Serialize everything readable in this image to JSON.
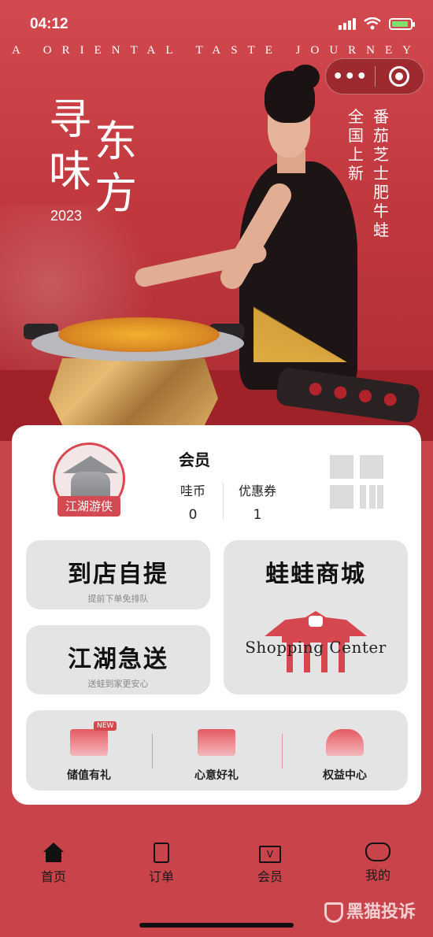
{
  "status_bar": {
    "time": "04:12"
  },
  "hero": {
    "tagline": "A ORIENTAL TASTE JOURNEY",
    "title_chars": [
      "寻",
      "东",
      "味",
      "方"
    ],
    "year": "2023",
    "promo_vertical_1": "番茄芝士肥牛蛙",
    "promo_vertical_2": "全国上新"
  },
  "capsule": {
    "more": "•••"
  },
  "member": {
    "level_badge": "江湖游侠",
    "title": "会员",
    "coins_label": "哇币",
    "coins_value": "0",
    "coupons_label": "优惠券",
    "coupons_value": "1"
  },
  "services": {
    "pickup_title": "到店自提",
    "pickup_sub": "提前下单免排队",
    "delivery_title": "江湖急送",
    "delivery_sub": "送蛙到家更安心",
    "mall_title": "蛙蛙商城",
    "mall_sub": "Shopping Center"
  },
  "mini_services": [
    {
      "label": "储值有礼",
      "badge": "NEW",
      "icon": "stored-value-card-icon"
    },
    {
      "label": "心意好礼",
      "icon": "gift-box-icon"
    },
    {
      "label": "权益中心",
      "icon": "cloud-benefits-icon"
    }
  ],
  "tabbar": [
    {
      "label": "首页",
      "icon": "home-icon"
    },
    {
      "label": "订单",
      "icon": "order-icon"
    },
    {
      "label": "会员",
      "icon": "member-card-icon",
      "glyph": "V"
    },
    {
      "label": "我的",
      "icon": "profile-icon"
    }
  ],
  "watermark": "黑猫投诉",
  "colors": {
    "brand_red": "#d34a52",
    "hero_red": "#c33a40",
    "tile_gray": "#e4e4e4"
  }
}
